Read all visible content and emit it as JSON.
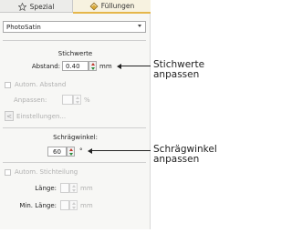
{
  "tabs": [
    {
      "label": "Spezial",
      "icon": "star-icon",
      "active": false
    },
    {
      "label": "Füllungen",
      "icon": "fill-icon",
      "active": true
    }
  ],
  "fill_type": {
    "value": "PhotoSatin"
  },
  "stichwerte": {
    "title": "Stichwerte",
    "abstand_label": "Abstand:",
    "abstand_value": "0.40",
    "abstand_unit": "mm"
  },
  "autom_abstand": {
    "label": "Autom. Abstand",
    "anpassen_label": "Anpassen:",
    "anpassen_unit": "%",
    "einstellungen_label": "Einstellungen..."
  },
  "schraegwinkel": {
    "title": "Schrägwinkel:",
    "value": "60",
    "unit": "°"
  },
  "autom_stichteilung": {
    "label": "Autom. Stichteilung",
    "laenge_label": "Länge:",
    "laenge_unit": "mm",
    "min_laenge_label": "Min. Länge:",
    "min_laenge_unit": "mm"
  },
  "annotations": [
    {
      "lines": [
        "Stichwerte",
        "anpassen"
      ]
    },
    {
      "lines": [
        "Schrägwinkel",
        "anpassen"
      ]
    }
  ],
  "colors": {
    "accent_tab": "#e5b64a",
    "spin_up": "#c0392b",
    "spin_down": "#2a8a3a"
  }
}
